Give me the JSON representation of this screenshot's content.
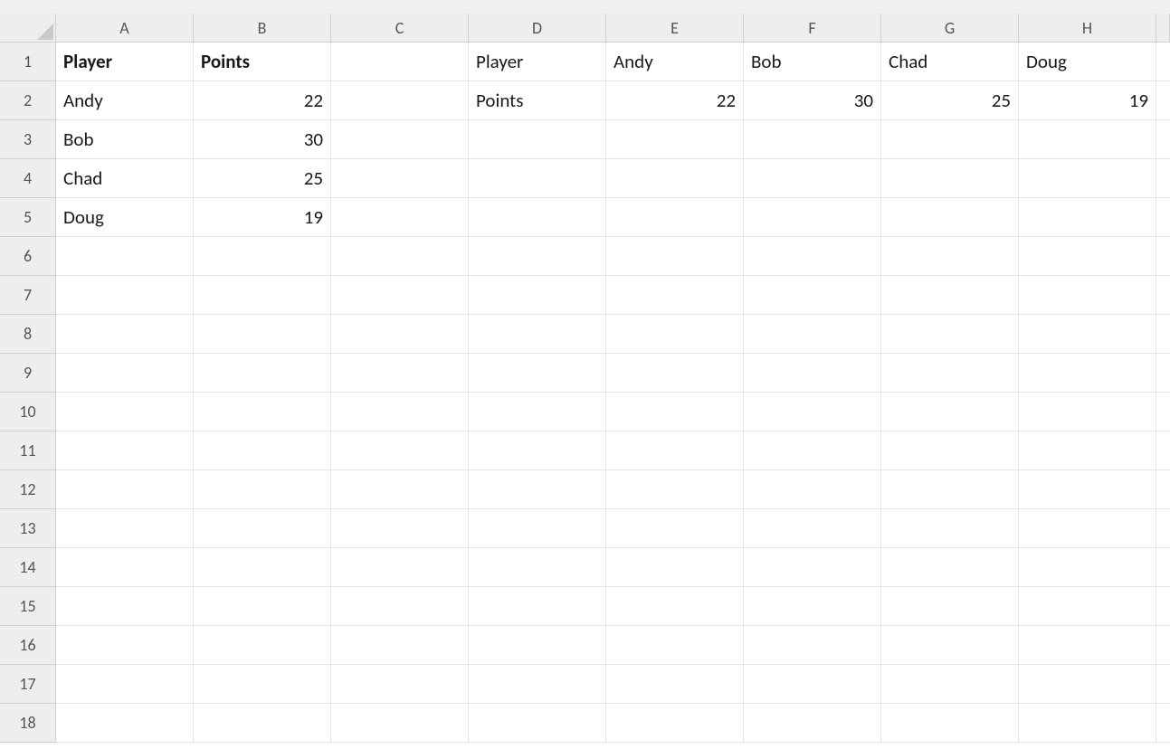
{
  "columns": [
    "A",
    "B",
    "C",
    "D",
    "E",
    "F",
    "G",
    "H"
  ],
  "rows": [
    "1",
    "2",
    "3",
    "4",
    "5",
    "6",
    "7",
    "8",
    "9",
    "10",
    "11",
    "12",
    "13",
    "14",
    "15",
    "16",
    "17",
    "18"
  ],
  "cells": {
    "A1": "Player",
    "B1": "Points",
    "A2": "Andy",
    "B2": "22",
    "A3": "Bob",
    "B3": "30",
    "A4": "Chad",
    "B4": "25",
    "A5": "Doug",
    "B5": "19",
    "D1": "Player",
    "E1": "Andy",
    "F1": "Bob",
    "G1": "Chad",
    "H1": "Doug",
    "D2": "Points",
    "E2": "22",
    "F2": "30",
    "G2": "25",
    "H2": "19"
  },
  "bold": [
    "A1",
    "B1"
  ],
  "numeric": [
    "B2",
    "B3",
    "B4",
    "B5",
    "E2",
    "F2",
    "G2",
    "H2"
  ]
}
